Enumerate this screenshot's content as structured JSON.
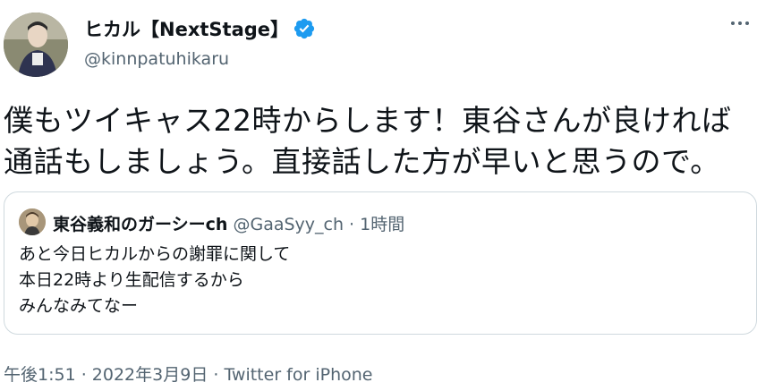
{
  "author": {
    "display_name": "ヒカル【NextStage】",
    "handle": "@kinnpatuhikaru",
    "verified_badge_icon": "verified-check-icon",
    "verified_color": "#1d9bf0"
  },
  "more_icon": "more-horizontal-icon",
  "tweet": {
    "text": "僕もツイキャス22時からします！東谷さんが良ければ\n通話もしましょう。直接話した方が早いと思うので。"
  },
  "quoted": {
    "display_name": "東谷義和のガーシーch",
    "handle": "@GaaSyy_ch",
    "separator": " · ",
    "time": "1時間",
    "text": "あと今日ヒカルからの謝罪に関して\n本日22時より生配信するから\nみんなみてなー"
  },
  "footer": {
    "time": "午後1:51",
    "sep1": " · ",
    "date": "2022年3月9日",
    "sep2": " · ",
    "source": "Twitter for iPhone"
  }
}
